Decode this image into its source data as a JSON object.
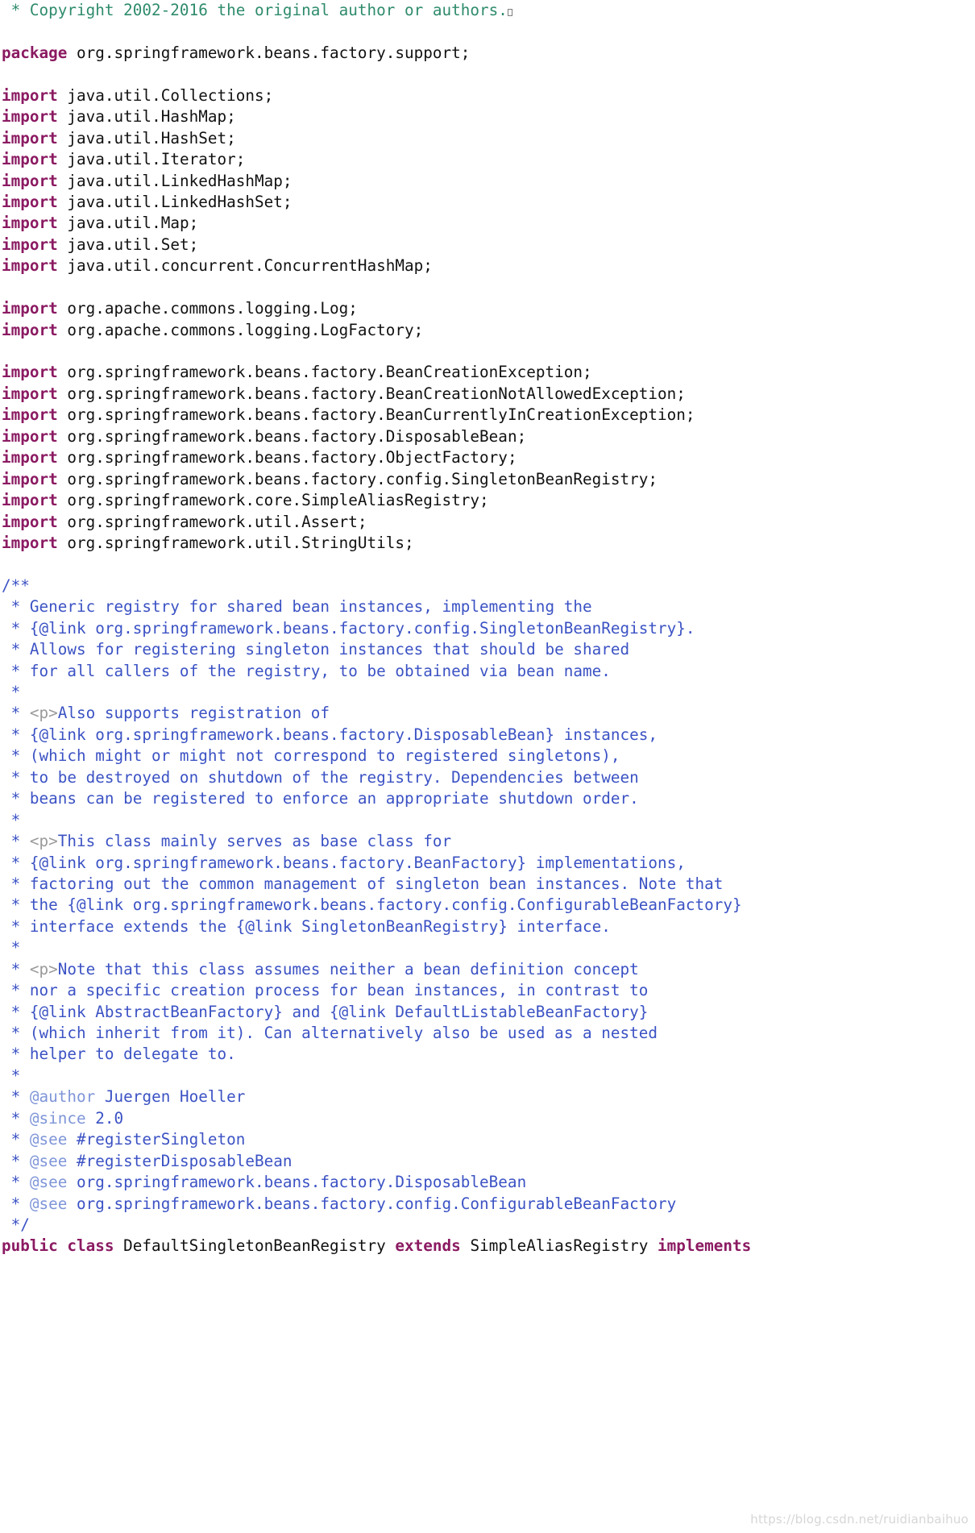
{
  "document": {
    "type": "java-source-listing",
    "language": "Java",
    "background_color": "#ffffff",
    "colors": {
      "header_comment": "#2E8B6B",
      "keyword": "#8B1A62",
      "plain": "#111111",
      "javadoc": "#3B52C4",
      "javadoc_tag": "#7E95D8",
      "html_tag_in_javadoc": "#9A9A9A",
      "watermark": "#cfcfcf"
    }
  },
  "watermark": {
    "text": "https://blog.csdn.net/ruidianbaihuo"
  },
  "lines": [
    {
      "kind": "comment",
      "tokens": [
        {
          "c": "comment",
          "t": " * Copyright 2002-2016 the original author or authors."
        },
        {
          "c": "missing",
          "t": ""
        }
      ]
    },
    {
      "kind": "blank",
      "tokens": []
    },
    {
      "kind": "code",
      "tokens": [
        {
          "c": "keyword",
          "t": "package"
        },
        {
          "c": "plain",
          "t": " org.springframework.beans.factory.support;"
        }
      ]
    },
    {
      "kind": "blank",
      "tokens": []
    },
    {
      "kind": "code",
      "tokens": [
        {
          "c": "keyword",
          "t": "import"
        },
        {
          "c": "plain",
          "t": " java.util.Collections;"
        }
      ]
    },
    {
      "kind": "code",
      "tokens": [
        {
          "c": "keyword",
          "t": "import"
        },
        {
          "c": "plain",
          "t": " java.util.HashMap;"
        }
      ]
    },
    {
      "kind": "code",
      "tokens": [
        {
          "c": "keyword",
          "t": "import"
        },
        {
          "c": "plain",
          "t": " java.util.HashSet;"
        }
      ]
    },
    {
      "kind": "code",
      "tokens": [
        {
          "c": "keyword",
          "t": "import"
        },
        {
          "c": "plain",
          "t": " java.util.Iterator;"
        }
      ]
    },
    {
      "kind": "code",
      "tokens": [
        {
          "c": "keyword",
          "t": "import"
        },
        {
          "c": "plain",
          "t": " java.util.LinkedHashMap;"
        }
      ]
    },
    {
      "kind": "code",
      "tokens": [
        {
          "c": "keyword",
          "t": "import"
        },
        {
          "c": "plain",
          "t": " java.util.LinkedHashSet;"
        }
      ]
    },
    {
      "kind": "code",
      "tokens": [
        {
          "c": "keyword",
          "t": "import"
        },
        {
          "c": "plain",
          "t": " java.util.Map;"
        }
      ]
    },
    {
      "kind": "code",
      "tokens": [
        {
          "c": "keyword",
          "t": "import"
        },
        {
          "c": "plain",
          "t": " java.util.Set;"
        }
      ]
    },
    {
      "kind": "code",
      "tokens": [
        {
          "c": "keyword",
          "t": "import"
        },
        {
          "c": "plain",
          "t": " java.util.concurrent.ConcurrentHashMap;"
        }
      ]
    },
    {
      "kind": "blank",
      "tokens": []
    },
    {
      "kind": "code",
      "tokens": [
        {
          "c": "keyword",
          "t": "import"
        },
        {
          "c": "plain",
          "t": " org.apache.commons.logging.Log;"
        }
      ]
    },
    {
      "kind": "code",
      "tokens": [
        {
          "c": "keyword",
          "t": "import"
        },
        {
          "c": "plain",
          "t": " org.apache.commons.logging.LogFactory;"
        }
      ]
    },
    {
      "kind": "blank",
      "tokens": []
    },
    {
      "kind": "code",
      "tokens": [
        {
          "c": "keyword",
          "t": "import"
        },
        {
          "c": "plain",
          "t": " org.springframework.beans.factory.BeanCreationException;"
        }
      ]
    },
    {
      "kind": "code",
      "tokens": [
        {
          "c": "keyword",
          "t": "import"
        },
        {
          "c": "plain",
          "t": " org.springframework.beans.factory.BeanCreationNotAllowedException;"
        }
      ]
    },
    {
      "kind": "code",
      "tokens": [
        {
          "c": "keyword",
          "t": "import"
        },
        {
          "c": "plain",
          "t": " org.springframework.beans.factory.BeanCurrentlyInCreationException;"
        }
      ]
    },
    {
      "kind": "code",
      "tokens": [
        {
          "c": "keyword",
          "t": "import"
        },
        {
          "c": "plain",
          "t": " org.springframework.beans.factory.DisposableBean;"
        }
      ]
    },
    {
      "kind": "code",
      "tokens": [
        {
          "c": "keyword",
          "t": "import"
        },
        {
          "c": "plain",
          "t": " org.springframework.beans.factory.ObjectFactory;"
        }
      ]
    },
    {
      "kind": "code",
      "tokens": [
        {
          "c": "keyword",
          "t": "import"
        },
        {
          "c": "plain",
          "t": " org.springframework.beans.factory.config.SingletonBeanRegistry;"
        }
      ]
    },
    {
      "kind": "code",
      "tokens": [
        {
          "c": "keyword",
          "t": "import"
        },
        {
          "c": "plain",
          "t": " org.springframework.core.SimpleAliasRegistry;"
        }
      ]
    },
    {
      "kind": "code",
      "tokens": [
        {
          "c": "keyword",
          "t": "import"
        },
        {
          "c": "plain",
          "t": " org.springframework.util.Assert;"
        }
      ]
    },
    {
      "kind": "code",
      "tokens": [
        {
          "c": "keyword",
          "t": "import"
        },
        {
          "c": "plain",
          "t": " org.springframework.util.StringUtils;"
        }
      ]
    },
    {
      "kind": "blank",
      "tokens": []
    },
    {
      "kind": "javadoc",
      "tokens": [
        {
          "c": "javadoc",
          "t": "/**"
        }
      ]
    },
    {
      "kind": "javadoc",
      "tokens": [
        {
          "c": "javadoc",
          "t": " * Generic registry for shared bean instances, implementing the"
        }
      ]
    },
    {
      "kind": "javadoc",
      "tokens": [
        {
          "c": "javadoc",
          "t": " * {@link org.springframework.beans.factory.config.SingletonBeanRegistry}."
        }
      ]
    },
    {
      "kind": "javadoc",
      "tokens": [
        {
          "c": "javadoc",
          "t": " * Allows for registering singleton instances that should be shared"
        }
      ]
    },
    {
      "kind": "javadoc",
      "tokens": [
        {
          "c": "javadoc",
          "t": " * for all callers of the registry, to be obtained via bean name."
        }
      ]
    },
    {
      "kind": "javadoc",
      "tokens": [
        {
          "c": "javadoc",
          "t": " *"
        }
      ]
    },
    {
      "kind": "javadoc",
      "tokens": [
        {
          "c": "javadoc",
          "t": " * "
        },
        {
          "c": "htmltag",
          "t": "<p>"
        },
        {
          "c": "javadoc",
          "t": "Also supports registration of"
        }
      ]
    },
    {
      "kind": "javadoc",
      "tokens": [
        {
          "c": "javadoc",
          "t": " * {@link org.springframework.beans.factory.DisposableBean} instances,"
        }
      ]
    },
    {
      "kind": "javadoc",
      "tokens": [
        {
          "c": "javadoc",
          "t": " * (which might or might not correspond to registered singletons),"
        }
      ]
    },
    {
      "kind": "javadoc",
      "tokens": [
        {
          "c": "javadoc",
          "t": " * to be destroyed on shutdown of the registry. Dependencies between"
        }
      ]
    },
    {
      "kind": "javadoc",
      "tokens": [
        {
          "c": "javadoc",
          "t": " * beans can be registered to enforce an appropriate shutdown order."
        }
      ]
    },
    {
      "kind": "javadoc",
      "tokens": [
        {
          "c": "javadoc",
          "t": " *"
        }
      ]
    },
    {
      "kind": "javadoc",
      "tokens": [
        {
          "c": "javadoc",
          "t": " * "
        },
        {
          "c": "htmltag",
          "t": "<p>"
        },
        {
          "c": "javadoc",
          "t": "This class mainly serves as base class for"
        }
      ]
    },
    {
      "kind": "javadoc",
      "tokens": [
        {
          "c": "javadoc",
          "t": " * {@link org.springframework.beans.factory.BeanFactory} implementations,"
        }
      ]
    },
    {
      "kind": "javadoc",
      "tokens": [
        {
          "c": "javadoc",
          "t": " * factoring out the common management of singleton bean instances. Note that"
        }
      ]
    },
    {
      "kind": "javadoc",
      "tokens": [
        {
          "c": "javadoc",
          "t": " * the {@link org.springframework.beans.factory.config.ConfigurableBeanFactory}"
        }
      ]
    },
    {
      "kind": "javadoc",
      "tokens": [
        {
          "c": "javadoc",
          "t": " * interface extends the {@link SingletonBeanRegistry} interface."
        }
      ]
    },
    {
      "kind": "javadoc",
      "tokens": [
        {
          "c": "javadoc",
          "t": " *"
        }
      ]
    },
    {
      "kind": "javadoc",
      "tokens": [
        {
          "c": "javadoc",
          "t": " * "
        },
        {
          "c": "htmltag",
          "t": "<p>"
        },
        {
          "c": "javadoc",
          "t": "Note that this class assumes neither a bean definition concept"
        }
      ]
    },
    {
      "kind": "javadoc",
      "tokens": [
        {
          "c": "javadoc",
          "t": " * nor a specific creation process for bean instances, in contrast to"
        }
      ]
    },
    {
      "kind": "javadoc",
      "tokens": [
        {
          "c": "javadoc",
          "t": " * {@link AbstractBeanFactory} and {@link DefaultListableBeanFactory}"
        }
      ]
    },
    {
      "kind": "javadoc",
      "tokens": [
        {
          "c": "javadoc",
          "t": " * (which inherit from it). Can alternatively also be used as a nested"
        }
      ]
    },
    {
      "kind": "javadoc",
      "tokens": [
        {
          "c": "javadoc",
          "t": " * helper to delegate to."
        }
      ]
    },
    {
      "kind": "javadoc",
      "tokens": [
        {
          "c": "javadoc",
          "t": " *"
        }
      ]
    },
    {
      "kind": "javadoc",
      "tokens": [
        {
          "c": "javadoc",
          "t": " * "
        },
        {
          "c": "jdtag",
          "t": "@author"
        },
        {
          "c": "javadoc",
          "t": " Juergen Hoeller"
        }
      ]
    },
    {
      "kind": "javadoc",
      "tokens": [
        {
          "c": "javadoc",
          "t": " * "
        },
        {
          "c": "jdtag",
          "t": "@since"
        },
        {
          "c": "javadoc",
          "t": " 2.0"
        }
      ]
    },
    {
      "kind": "javadoc",
      "tokens": [
        {
          "c": "javadoc",
          "t": " * "
        },
        {
          "c": "jdtag",
          "t": "@see"
        },
        {
          "c": "javadoc",
          "t": " #registerSingleton"
        }
      ]
    },
    {
      "kind": "javadoc",
      "tokens": [
        {
          "c": "javadoc",
          "t": " * "
        },
        {
          "c": "jdtag",
          "t": "@see"
        },
        {
          "c": "javadoc",
          "t": " #registerDisposableBean"
        }
      ]
    },
    {
      "kind": "javadoc",
      "tokens": [
        {
          "c": "javadoc",
          "t": " * "
        },
        {
          "c": "jdtag",
          "t": "@see"
        },
        {
          "c": "javadoc",
          "t": " org.springframework.beans.factory.DisposableBean"
        }
      ]
    },
    {
      "kind": "javadoc",
      "tokens": [
        {
          "c": "javadoc",
          "t": " * "
        },
        {
          "c": "jdtag",
          "t": "@see"
        },
        {
          "c": "javadoc",
          "t": " org.springframework.beans.factory.config.ConfigurableBeanFactory"
        }
      ]
    },
    {
      "kind": "javadoc",
      "tokens": [
        {
          "c": "javadoc",
          "t": " */"
        }
      ]
    },
    {
      "kind": "code",
      "tokens": [
        {
          "c": "keyword",
          "t": "public class"
        },
        {
          "c": "plain",
          "t": " DefaultSingletonBeanRegistry "
        },
        {
          "c": "keyword",
          "t": "extends"
        },
        {
          "c": "plain",
          "t": " SimpleAliasRegistry "
        },
        {
          "c": "keyword",
          "t": "implements"
        }
      ]
    }
  ]
}
